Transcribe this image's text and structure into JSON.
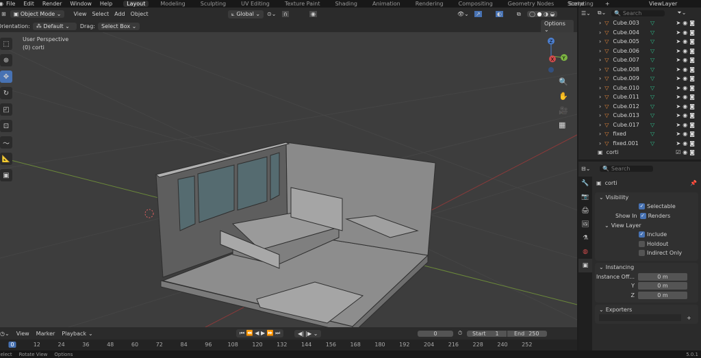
{
  "menu": [
    "File",
    "Edit",
    "Render",
    "Window",
    "Help"
  ],
  "workspaces": [
    "Layout",
    "Modeling",
    "Sculpting",
    "UV Editing",
    "Texture Paint",
    "Shading",
    "Animation",
    "Rendering",
    "Compositing",
    "Geometry Nodes",
    "Scripting"
  ],
  "active_workspace": "Layout",
  "scene": "Scene",
  "view_layer": "ViewLayer",
  "header": {
    "mode": "Object Mode",
    "menus": [
      "View",
      "Select",
      "Add",
      "Object"
    ],
    "transform": "Global"
  },
  "tool_settings": {
    "orientation_label": "Orientation:",
    "orientation": "Default",
    "drag_label": "Drag:",
    "drag": "Select Box",
    "options": "Options"
  },
  "viewport": {
    "view_name": "User Perspective",
    "object": "(0) corti"
  },
  "gizmo": {
    "z": "Z",
    "y": "Y",
    "x": "X"
  },
  "outliner": {
    "search_placeholder": "Search",
    "items": [
      "Cube.003",
      "Cube.004",
      "Cube.005",
      "Cube.006",
      "Cube.007",
      "Cube.008",
      "Cube.009",
      "Cube.010",
      "Cube.011",
      "Cube.012",
      "Cube.013",
      "Cube.017",
      "fixed",
      "fixed.001"
    ],
    "collection": "corti"
  },
  "properties": {
    "search_placeholder": "Search",
    "name": "corti",
    "visibility": {
      "title": "Visibility",
      "selectable": "Selectable",
      "show_in": "Show In",
      "renders": "Renders",
      "view_layer": "View Layer",
      "include": "Include",
      "holdout": "Holdout",
      "indirect": "Indirect Only"
    },
    "instancing": {
      "title": "Instancing",
      "offset_label": "Instance Off...",
      "x": "0 m",
      "y_label": "Y",
      "y": "0 m",
      "z_label": "Z",
      "z": "0 m"
    },
    "exporters": {
      "title": "Exporters"
    }
  },
  "timeline": {
    "menus": [
      "View",
      "Marker",
      "Playback"
    ],
    "current": "0",
    "start_label": "Start",
    "start": "1",
    "end_label": "End",
    "end": "250",
    "ticks": [
      "0",
      "12",
      "24",
      "36",
      "48",
      "60",
      "72",
      "84",
      "96",
      "108",
      "120",
      "132",
      "144",
      "156",
      "168",
      "180",
      "192",
      "204",
      "216",
      "228",
      "240",
      "252"
    ]
  },
  "status": {
    "select": "Select",
    "rotate": "Rotate View",
    "options": "Options",
    "version": "5.0.1"
  }
}
